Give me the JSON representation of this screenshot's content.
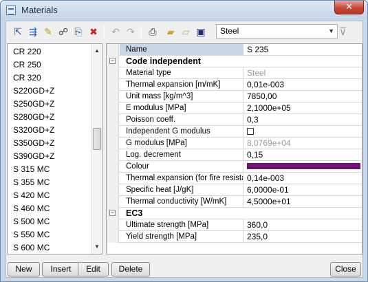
{
  "window": {
    "title": "Materials",
    "close_label": "✕"
  },
  "toolbar": {
    "icons": [
      "add-material-icon",
      "import-icon",
      "edit-icon",
      "binoculars-icon",
      "copy-icon",
      "delete-icon",
      "undo-icon",
      "redo-icon",
      "print-icon",
      "open-folder-icon",
      "open-icon",
      "save-icon"
    ],
    "material_select_value": "Steel",
    "filter_icon": "funnel-icon"
  },
  "materials_list": [
    "CR 220",
    "CR 250",
    "CR 320",
    "S220GD+Z",
    "S250GD+Z",
    "S280GD+Z",
    "S320GD+Z",
    "S350GD+Z",
    "S390GD+Z",
    "S 315 MC",
    "S 355 MC",
    "S 420 MC",
    "S 460 MC",
    "S 500 MC",
    "S 550 MC",
    "S 600 MC"
  ],
  "properties": {
    "header": {
      "name": "Name",
      "value": "S 235"
    },
    "section_code_independent": "Code independent",
    "code_independent_rows": [
      {
        "name": "Material type",
        "value": "Steel"
      },
      {
        "name": "Thermal expansion  [m/mK]",
        "value": "0,01e-003"
      },
      {
        "name": "Unit mass [kg/m^3]",
        "value": "7850,00"
      },
      {
        "name": "E modulus [MPa]",
        "value": "2,1000e+05"
      },
      {
        "name": "Poisson coeff.",
        "value": "0,3"
      },
      {
        "name": "Independent G modulus",
        "value": ""
      },
      {
        "name": "G modulus [MPa]",
        "value": "8,0769e+04"
      },
      {
        "name": "Log. decrement",
        "value": "0,15"
      },
      {
        "name": "Colour",
        "value": ""
      },
      {
        "name": "Thermal expansion  (for fire resista...",
        "value": "0,14e-003"
      },
      {
        "name": "Specific heat [J/gK]",
        "value": "6,0000e-01"
      },
      {
        "name": "Thermal conductivity [W/mK]",
        "value": "4,5000e+01"
      }
    ],
    "section_ec3": "EC3",
    "ec3_rows": [
      {
        "name": "Ultimate strength [MPa]",
        "value": "360,0"
      },
      {
        "name": "Yield strength [MPa]",
        "value": "235,0"
      }
    ],
    "colour_swatch": "#7b0f78",
    "independent_g_modulus_checked": false
  },
  "buttons": {
    "new": "New",
    "insert": "Insert",
    "edit": "Edit",
    "delete": "Delete",
    "close": "Close"
  }
}
